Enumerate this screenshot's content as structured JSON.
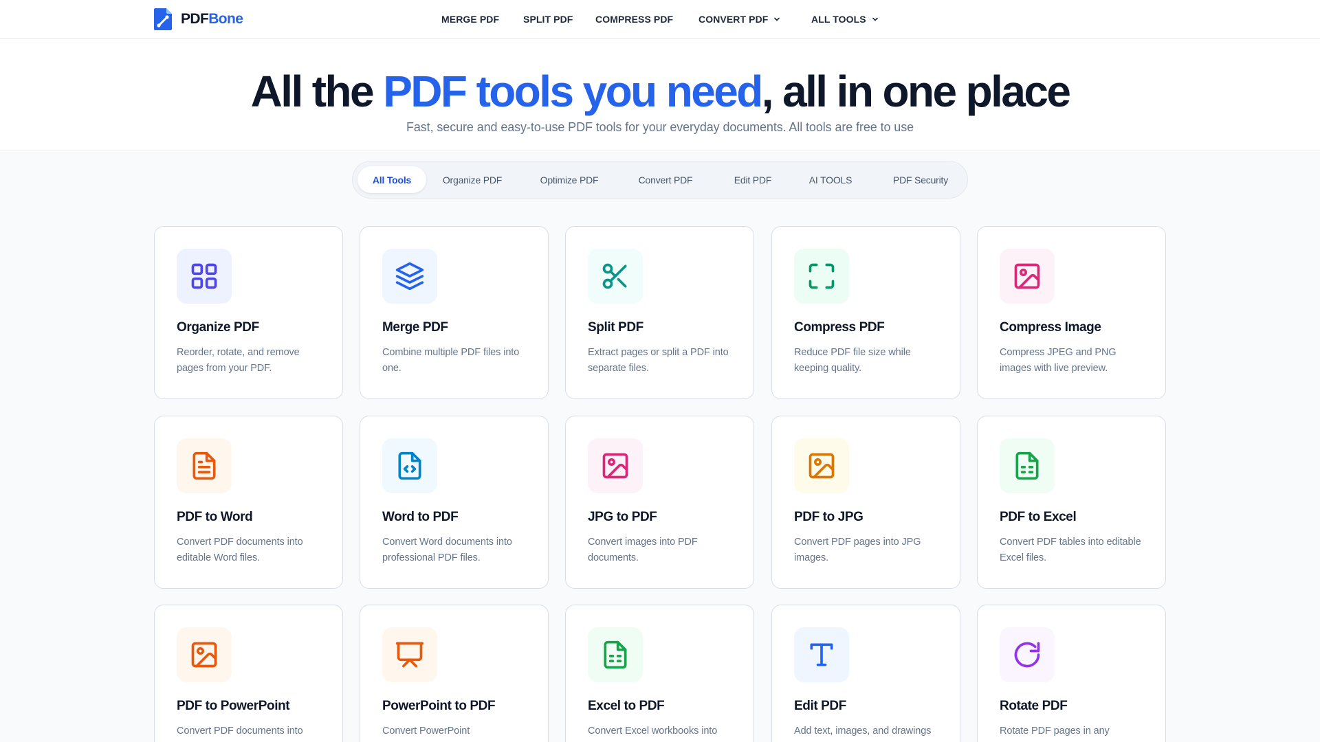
{
  "brand": {
    "name_part1": "PDF",
    "name_part2": "Bone",
    "accent_color": "#2563eb"
  },
  "nav": {
    "items": [
      {
        "label": "MERGE PDF",
        "icon": ""
      },
      {
        "label": "SPLIT PDF",
        "icon": ""
      },
      {
        "label": "COMPRESS PDF",
        "icon": ""
      },
      {
        "label": "CONVERT PDF",
        "icon": "chevron-down-icon"
      },
      {
        "label": "ALL TOOLS",
        "icon": "chevron-down-icon"
      }
    ]
  },
  "hero": {
    "title_start": "All the ",
    "title_accent": "PDF tools you need",
    "title_end": ", all in one place",
    "subtitle": "Fast, secure and easy-to-use PDF tools for your everyday documents. All tools are free to use"
  },
  "tabs": [
    {
      "label": "All Tools",
      "active": true
    },
    {
      "label": "Organize PDF",
      "active": false
    },
    {
      "label": "Optimize PDF",
      "active": false
    },
    {
      "label": "Convert PDF",
      "active": false
    },
    {
      "label": "Edit PDF",
      "active": false
    },
    {
      "label": "AI TOOLS",
      "active": false
    },
    {
      "label": "PDF Security",
      "active": false
    }
  ],
  "tools": [
    {
      "title": "Organize PDF",
      "description": "Reorder, rotate, and remove pages from your PDF.",
      "icon": "grid-icon",
      "color": "#4f46e5",
      "bg": "#eef2ff"
    },
    {
      "title": "Merge PDF",
      "description": "Combine multiple PDF files into one.",
      "icon": "layers-icon",
      "color": "#2563eb",
      "bg": "#eff6ff"
    },
    {
      "title": "Split PDF",
      "description": "Extract pages or split a PDF into separate files.",
      "icon": "scissors-icon",
      "color": "#0d9488",
      "bg": "#f0fdfa"
    },
    {
      "title": "Compress PDF",
      "description": "Reduce PDF file size while keeping quality.",
      "icon": "compress-frame-icon",
      "color": "#059669",
      "bg": "#ecfdf5"
    },
    {
      "title": "Compress Image",
      "description": "Compress JPEG and PNG images with live preview.",
      "icon": "image-icon",
      "color": "#db2777",
      "bg": "#fdf2f8"
    },
    {
      "title": "PDF to Word",
      "description": "Convert PDF documents into editable Word files.",
      "icon": "document-text-icon",
      "color": "#ea580c",
      "bg": "#fff7ed"
    },
    {
      "title": "Word to PDF",
      "description": "Convert Word documents into professional PDF files.",
      "icon": "code-file-icon",
      "color": "#0284c7",
      "bg": "#f0f9ff"
    },
    {
      "title": "JPG to PDF",
      "description": "Convert images into PDF documents.",
      "icon": "image-icon",
      "color": "#db2777",
      "bg": "#fdf2f8"
    },
    {
      "title": "PDF to JPG",
      "description": "Convert PDF pages into JPG images.",
      "icon": "image-icon",
      "color": "#d97706",
      "bg": "#fffbeb"
    },
    {
      "title": "PDF to Excel",
      "description": "Convert PDF tables into editable Excel files.",
      "icon": "spreadsheet-icon",
      "color": "#16a34a",
      "bg": "#f0fdf4"
    },
    {
      "title": "PDF to PowerPoint",
      "description": "Convert PDF documents into",
      "icon": "image-icon",
      "color": "#ea580c",
      "bg": "#fff7ed"
    },
    {
      "title": "PowerPoint to PDF",
      "description": "Convert PowerPoint",
      "icon": "presentation-icon",
      "color": "#ea580c",
      "bg": "#fff7ed"
    },
    {
      "title": "Excel to PDF",
      "description": "Convert Excel workbooks into",
      "icon": "spreadsheet-icon",
      "color": "#16a34a",
      "bg": "#f0fdf4"
    },
    {
      "title": "Edit PDF",
      "description": "Add text, images, and drawings",
      "icon": "text-t-icon",
      "color": "#2563eb",
      "bg": "#eff6ff"
    },
    {
      "title": "Rotate PDF",
      "description": "Rotate PDF pages in any",
      "icon": "rotate-icon",
      "color": "#9333ea",
      "bg": "#faf5ff"
    }
  ]
}
